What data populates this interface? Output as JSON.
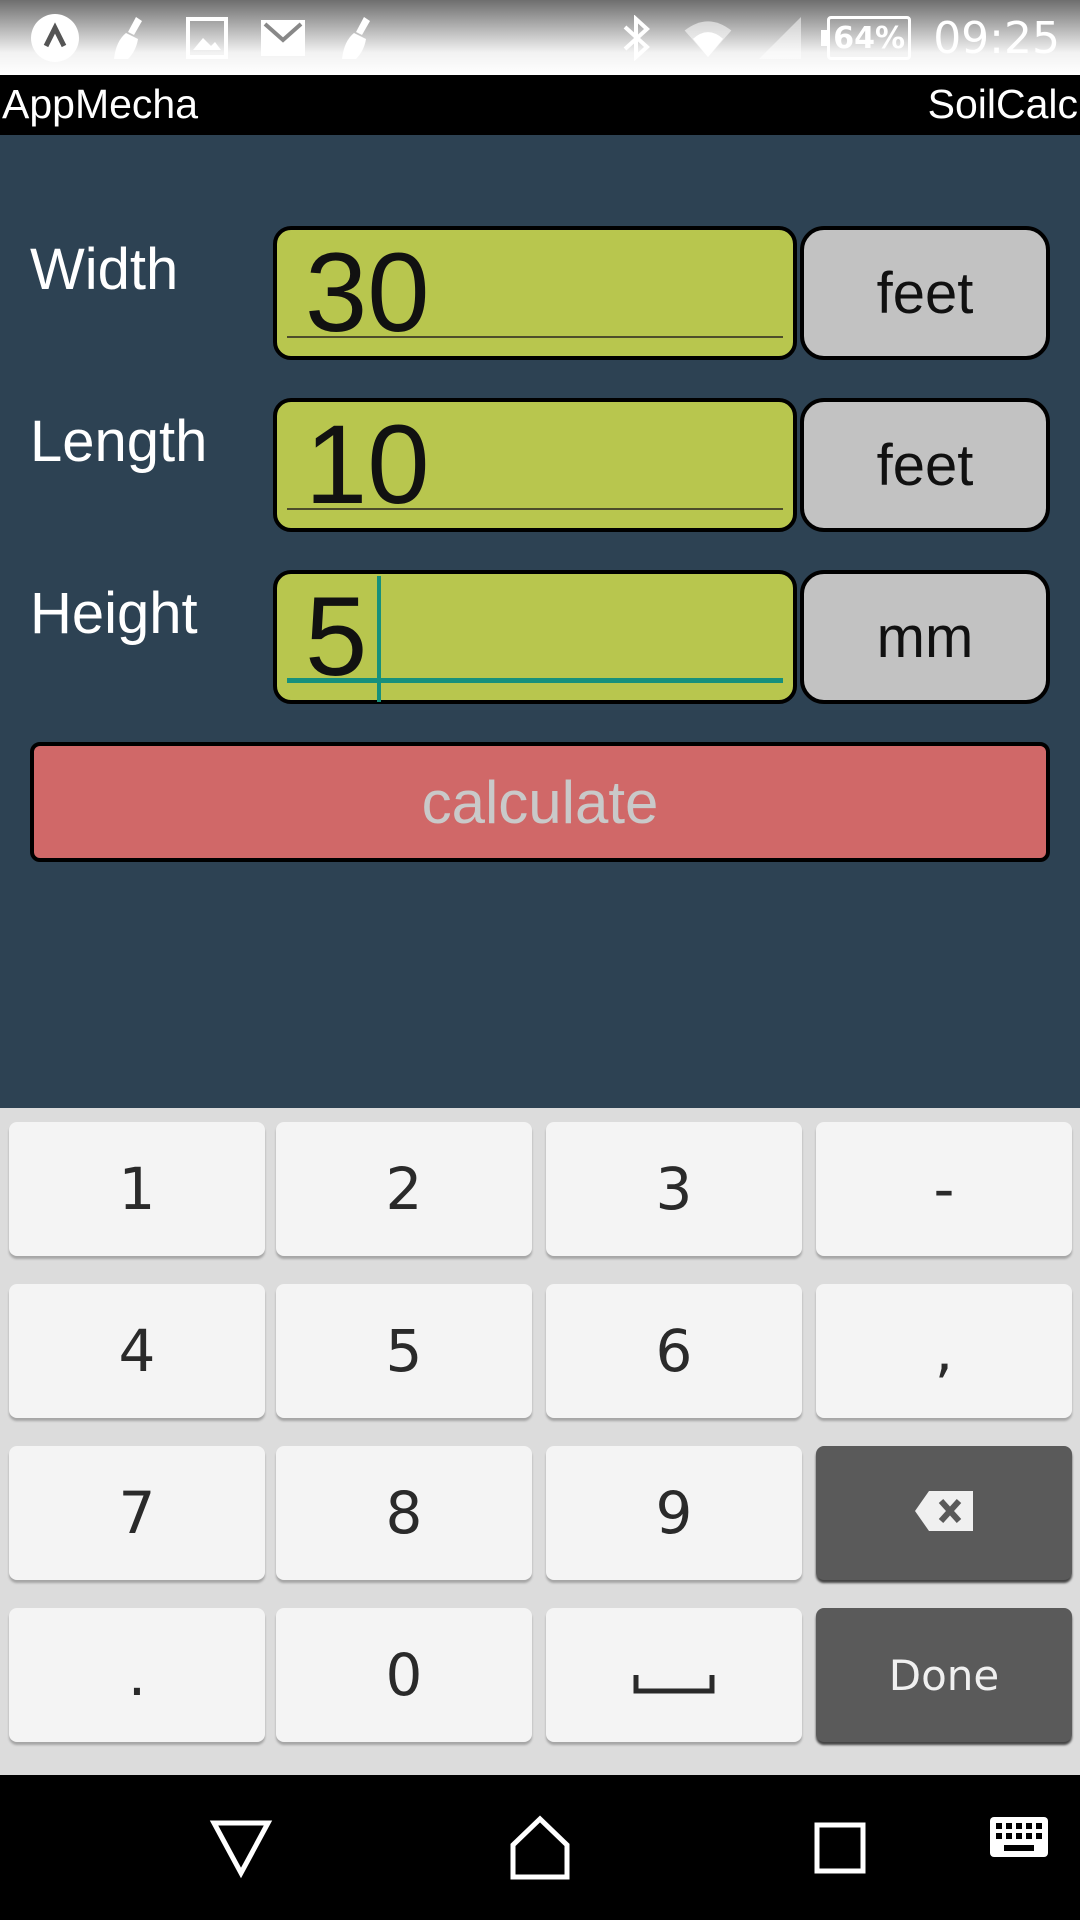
{
  "status_bar": {
    "left_icons": [
      "app-launcher-icon",
      "broom-icon",
      "image-icon",
      "gmail-icon",
      "broom-icon"
    ],
    "right_icons": [
      "bluetooth-icon",
      "wifi-icon",
      "signal-icon"
    ],
    "battery": "64%",
    "time": "09:25"
  },
  "action_bar": {
    "app_name": "AppMecha",
    "title": "SoilCalc"
  },
  "form": {
    "rows": [
      {
        "label": "Width",
        "value": "30",
        "unit": "feet"
      },
      {
        "label": "Length",
        "value": "10",
        "unit": "feet"
      },
      {
        "label": "Height",
        "value": "5",
        "unit": "mm"
      }
    ],
    "focused_row": 2,
    "calculate_label": "calculate"
  },
  "colors": {
    "background": "#2d4253",
    "field": "#b8c64e",
    "unit_button": "#c2c2c2",
    "calculate_button": "#d06868",
    "focus_accent": "#16907c"
  },
  "keyboard": {
    "rows": [
      [
        "1",
        "2",
        "3",
        "-"
      ],
      [
        "4",
        "5",
        "6",
        ","
      ],
      [
        "7",
        "8",
        "9",
        "backspace-icon"
      ],
      [
        ".",
        "0",
        "space-icon",
        "Done"
      ]
    ]
  },
  "nav_bar": {
    "icons": [
      "back-icon",
      "home-icon",
      "recents-icon",
      "keyboard-icon"
    ]
  }
}
